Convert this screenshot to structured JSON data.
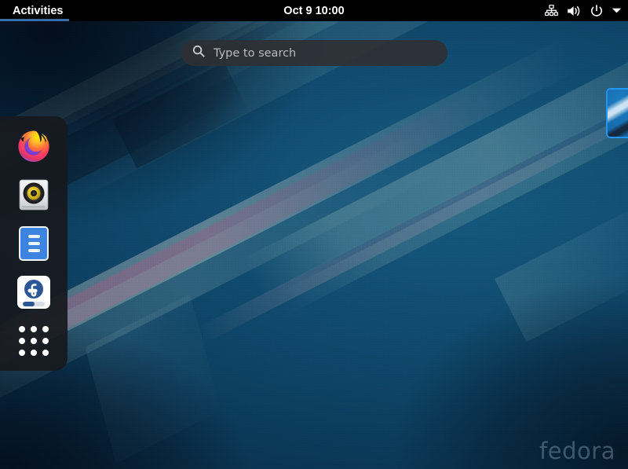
{
  "topbar": {
    "activities_label": "Activities",
    "clock": "Oct 9  10:00",
    "status_icons": [
      {
        "name": "network-wired-icon",
        "label": "Wired Network"
      },
      {
        "name": "volume-icon",
        "label": "Volume"
      },
      {
        "name": "power-icon",
        "label": "Power"
      },
      {
        "name": "chevron-down-icon",
        "label": "System Menu"
      }
    ],
    "background_color": "#000000",
    "text_color": "#ffffff",
    "active_underline_color": "#3a6ea8"
  },
  "search": {
    "placeholder": "Type to search",
    "value": "",
    "icon": "search-icon",
    "background_color": "#2e3034",
    "placeholder_color": "#b9bcc0"
  },
  "dock": {
    "background_color": "#17191e",
    "items": [
      {
        "name": "dock-item-firefox",
        "label": "Firefox",
        "icon": "firefox-icon"
      },
      {
        "name": "dock-item-rhythmbox",
        "label": "Rhythmbox",
        "icon": "media-player-icon"
      },
      {
        "name": "dock-item-files",
        "label": "Files",
        "icon": "files-cabinet-icon"
      },
      {
        "name": "dock-item-fedora",
        "label": "Fedora Media Writer",
        "icon": "fedora-logo-icon"
      }
    ],
    "show_apps_label": "Show Applications",
    "show_apps_icon": "app-grid-icon"
  },
  "workspace": {
    "window_thumbnail_label": "Window preview",
    "watermark": "fedora"
  },
  "desktop": {
    "wallpaper_name": "Fedora default blue abstract wallpaper",
    "accent_color": "#2196f3",
    "base_color": "#11537c"
  }
}
